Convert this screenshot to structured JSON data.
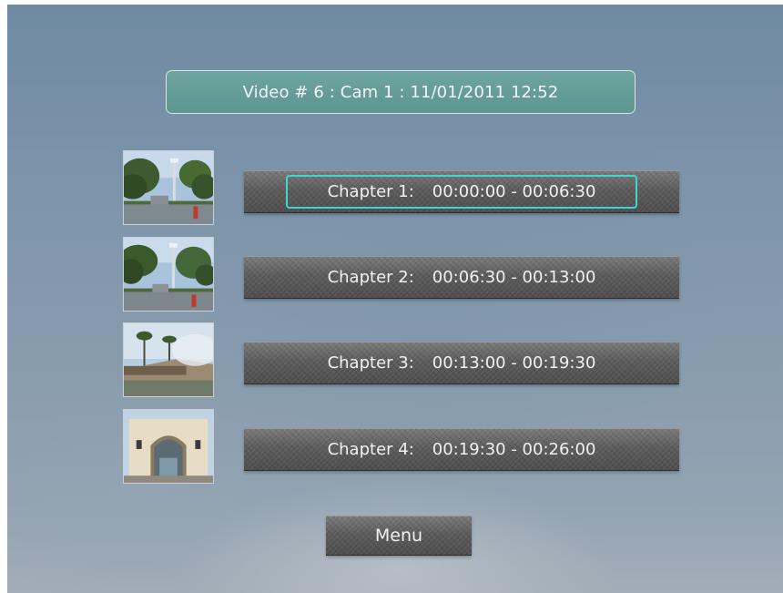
{
  "header": {
    "title": "Video # 6 : Cam 1 : 11/01/2011 12:52"
  },
  "chapters": [
    {
      "name": "Chapter 1:",
      "range": "00:00:00 - 00:06:30",
      "selected": true,
      "thumbnail": "street-trees-thumbnail"
    },
    {
      "name": "Chapter 2:",
      "range": "00:06:30 - 00:13:00",
      "selected": false,
      "thumbnail": "street-trees-thumbnail"
    },
    {
      "name": "Chapter 3:",
      "range": "00:13:00 - 00:19:30",
      "selected": false,
      "thumbnail": "palm-trees-building-thumbnail"
    },
    {
      "name": "Chapter 4:",
      "range": "00:19:30 - 00:26:00",
      "selected": false,
      "thumbnail": "archway-building-thumbnail"
    }
  ],
  "menu": {
    "label": "Menu"
  },
  "colors": {
    "title_box": "#6fa5a1",
    "selection_highlight": "#3fd6d0",
    "button_face": "#5c5c5c",
    "background": "#7d94aa"
  }
}
